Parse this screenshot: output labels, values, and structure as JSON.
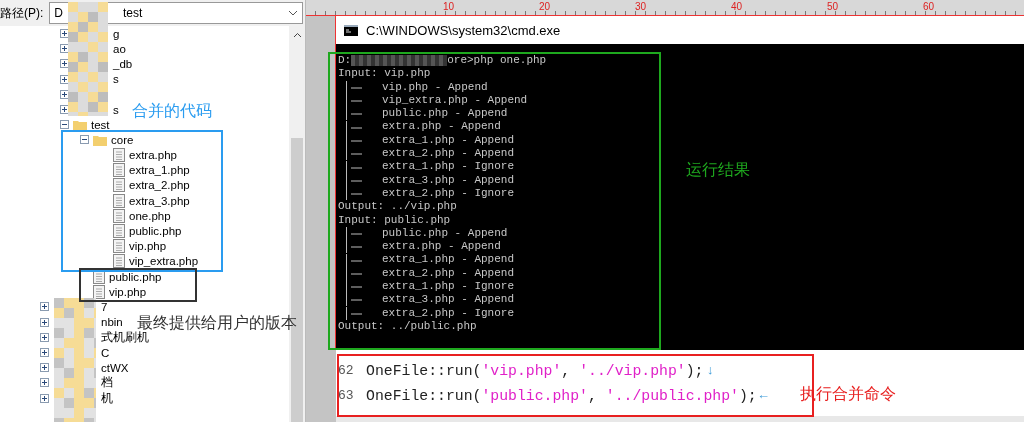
{
  "explorer": {
    "path_label": "路径(P):",
    "path_start": "D",
    "path_end": "test",
    "tree": [
      {
        "label": "g",
        "expanded": false
      },
      {
        "label": "ao",
        "expanded": false
      },
      {
        "label": "_db",
        "expanded": false
      },
      {
        "label": "s",
        "expanded": false
      },
      {
        "expanded": false
      },
      {
        "label": "s",
        "expanded": false
      },
      {
        "label": "test",
        "expanded": true,
        "children": [
          {
            "label": "core",
            "expanded": true,
            "children": [
              {
                "label": "extra.php"
              },
              {
                "label": "extra_1.php"
              },
              {
                "label": "extra_2.php"
              },
              {
                "label": "extra_3.php"
              },
              {
                "label": "one.php"
              },
              {
                "label": "public.php"
              },
              {
                "label": "vip.php"
              },
              {
                "label": "vip_extra.php"
              }
            ]
          },
          {
            "label": "public.php"
          },
          {
            "label": "vip.php"
          }
        ]
      }
    ],
    "outer_tree": [
      {
        "label": "7",
        "expanded": false
      },
      {
        "label": "nbin",
        "expanded": false
      },
      {
        "label": "式机刷机",
        "expanded": false
      },
      {
        "label": "C",
        "expanded": false
      },
      {
        "label": "ctWX",
        "expanded": false
      },
      {
        "label": "档",
        "expanded": false
      },
      {
        "label": "机",
        "expanded": false
      }
    ]
  },
  "ruler": {
    "labels": [
      "10",
      "20",
      "30",
      "40",
      "50",
      "60"
    ]
  },
  "console": {
    "title": "C:\\WINDOWS\\system32\\cmd.exe",
    "prompt_start": "D:",
    "prompt_end": "ore>php one.php",
    "lines": [
      {
        "kind": "plain",
        "text": "Input: vip.php"
      },
      {
        "kind": "branch",
        "text": "vip.php - Append"
      },
      {
        "kind": "branch",
        "text": "vip_extra.php - Append"
      },
      {
        "kind": "branch",
        "text": "public.php - Append"
      },
      {
        "kind": "branch",
        "text": "extra.php - Append"
      },
      {
        "kind": "branch",
        "text": "extra_1.php - Append"
      },
      {
        "kind": "branch",
        "text": "extra_2.php - Append"
      },
      {
        "kind": "branch",
        "text": "extra_1.php - Ignore"
      },
      {
        "kind": "branch",
        "text": "extra_3.php - Append"
      },
      {
        "kind": "branch",
        "text": "extra_2.php - Ignore"
      },
      {
        "kind": "plain",
        "text": "Output: ../vip.php"
      },
      {
        "kind": "plain",
        "text": "Input: public.php"
      },
      {
        "kind": "branch",
        "text": "public.php - Append"
      },
      {
        "kind": "branch",
        "text": "extra.php - Append"
      },
      {
        "kind": "branch",
        "text": "extra_1.php - Append"
      },
      {
        "kind": "branch",
        "text": "extra_2.php - Append"
      },
      {
        "kind": "branch",
        "text": "extra_1.php - Ignore"
      },
      {
        "kind": "branch",
        "text": "extra_3.php - Append"
      },
      {
        "kind": "branch",
        "text": "extra_2.php - Ignore"
      },
      {
        "kind": "plain",
        "text": "Output: ../public.php"
      }
    ]
  },
  "editor": {
    "lines": [
      {
        "number": "62",
        "eol": "↓",
        "tokens": [
          {
            "kind": "plain",
            "text": "OneFile::run("
          },
          {
            "kind": "string",
            "text": "'vip.php'"
          },
          {
            "kind": "plain",
            "text": ", "
          },
          {
            "kind": "string",
            "text": "'../vip.php'"
          },
          {
            "kind": "plain",
            "text": ");"
          }
        ]
      },
      {
        "number": "63",
        "eol": "←",
        "tokens": [
          {
            "kind": "plain",
            "text": "OneFile::run("
          },
          {
            "kind": "string",
            "text": "'public.php'"
          },
          {
            "kind": "plain",
            "text": ", "
          },
          {
            "kind": "string",
            "text": "'../public.php'"
          },
          {
            "kind": "plain",
            "text": ");"
          }
        ]
      }
    ]
  },
  "annotations": [
    {
      "kind": "merged",
      "text": "合并的代码"
    },
    {
      "kind": "final",
      "text": "最终提供给用户的版本"
    },
    {
      "kind": "result",
      "text": "运行结果"
    },
    {
      "kind": "command",
      "text": "执行合并命令"
    }
  ]
}
